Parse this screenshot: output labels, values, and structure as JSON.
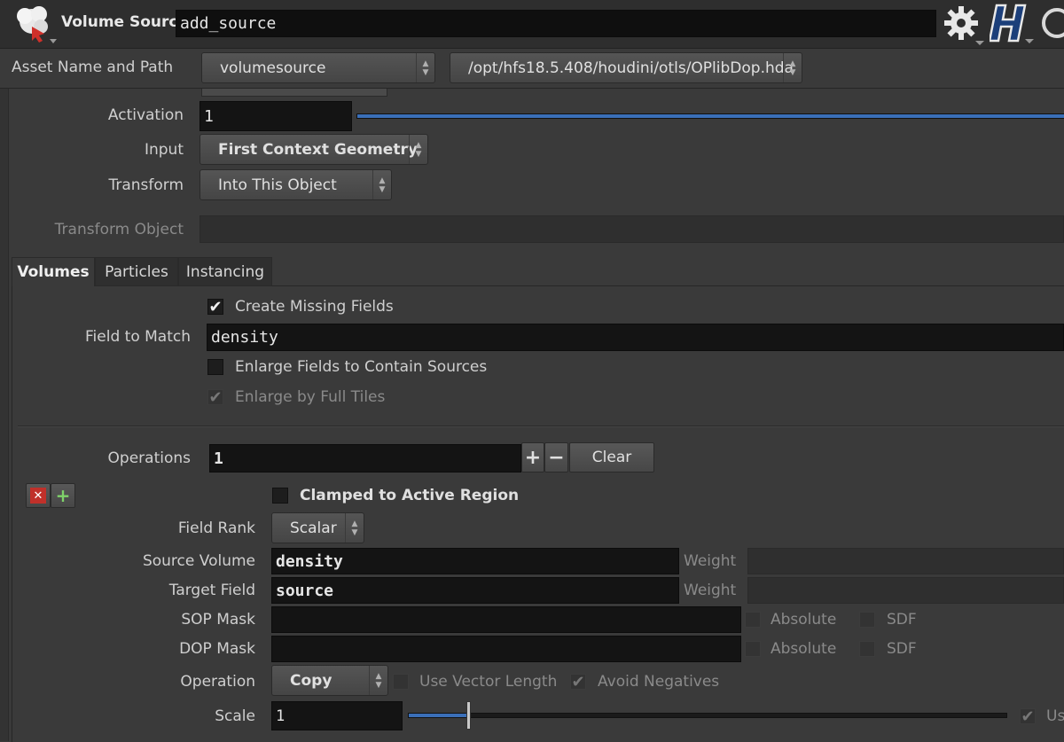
{
  "header": {
    "node_type": "Volume Source",
    "node_name": "add_source"
  },
  "asset": {
    "label": "Asset Name and Path",
    "name": "volumesource",
    "path": "/opt/hfs18.5.408/houdini/otls/OPlibDop.hda"
  },
  "params": {
    "activation_label": "Activation",
    "activation_value": "1",
    "input_label": "Input",
    "input_value": "First Context Geometry",
    "transform_label": "Transform",
    "transform_value": "Into This Object",
    "transform_object_label": "Transform Object"
  },
  "tabs": [
    {
      "label": "Volumes",
      "active": true
    },
    {
      "label": "Particles",
      "active": false
    },
    {
      "label": "Instancing",
      "active": false
    }
  ],
  "volumes": {
    "create_missing_label": "Create Missing Fields",
    "create_missing_checked": true,
    "field_to_match_label": "Field to Match",
    "field_to_match_value": "density",
    "enlarge_label": "Enlarge Fields to Contain Sources",
    "enlarge_checked": false,
    "full_tiles_label": "Enlarge by Full Tiles",
    "full_tiles_checked": true
  },
  "operations": {
    "label": "Operations",
    "count": "1",
    "plus": "+",
    "minus": "−",
    "clear_label": "Clear",
    "remove_icon": "✕",
    "insert_icon": "+"
  },
  "op": {
    "clamped_label": "Clamped to Active Region",
    "field_rank_label": "Field Rank",
    "field_rank_value": "Scalar",
    "source_volume_label": "Source Volume",
    "source_volume_value": "density",
    "target_field_label": "Target Field",
    "target_field_value": "source",
    "weight_label": "Weight",
    "sop_mask_label": "SOP Mask",
    "dop_mask_label": "DOP Mask",
    "absolute_label": "Absolute",
    "sdf_label": "SDF",
    "operation_label": "Operation",
    "operation_value": "Copy",
    "use_vector_length_label": "Use Vector Length",
    "avoid_negatives_label": "Avoid Negatives",
    "scale_label": "Scale",
    "scale_value": "1",
    "scale_slider": 0.1,
    "trailing_label": "Us"
  },
  "colors": {
    "accent_blue": "#3a6fb8"
  }
}
